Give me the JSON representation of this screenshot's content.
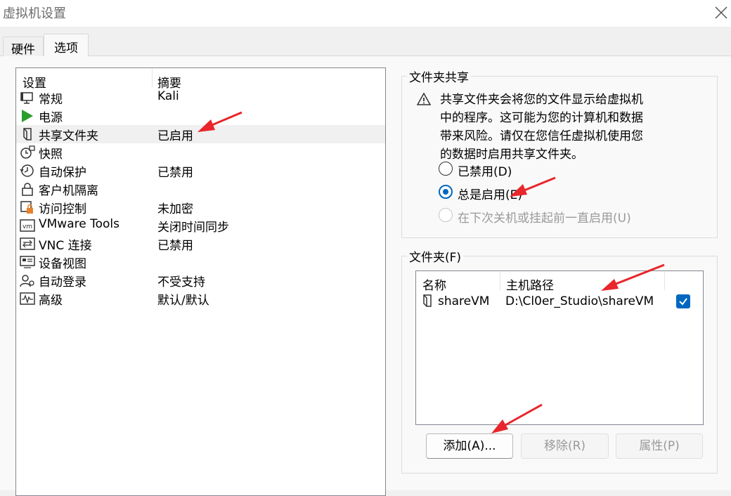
{
  "window": {
    "title": "虚拟机设置"
  },
  "tabs": [
    {
      "label": "硬件",
      "active": false
    },
    {
      "label": "选项",
      "active": true
    }
  ],
  "settings_list": {
    "headers": {
      "setting": "设置",
      "summary": "摘要"
    },
    "items": [
      {
        "name": "常规",
        "summary": "Kali",
        "icon": "monitor-icon"
      },
      {
        "name": "电源",
        "summary": "",
        "icon": "power-play-icon"
      },
      {
        "name": "共享文件夹",
        "summary": "已启用",
        "icon": "shared-folder-icon",
        "selected": true
      },
      {
        "name": "快照",
        "summary": "",
        "icon": "snapshot-icon"
      },
      {
        "name": "自动保护",
        "summary": "已禁用",
        "icon": "autoprotect-clock-icon"
      },
      {
        "name": "客户机隔离",
        "summary": "",
        "icon": "lock-icon"
      },
      {
        "name": "访问控制",
        "summary": "未加密",
        "icon": "access-control-icon"
      },
      {
        "name": "VMware Tools",
        "summary": "关闭时间同步",
        "icon": "vm-tools-icon"
      },
      {
        "name": "VNC 连接",
        "summary": "已禁用",
        "icon": "vnc-icon"
      },
      {
        "name": "设备视图",
        "summary": "",
        "icon": "device-view-icon"
      },
      {
        "name": "自动登录",
        "summary": "不受支持",
        "icon": "autologin-icon"
      },
      {
        "name": "高级",
        "summary": "默认/默认",
        "icon": "advanced-waveform-icon"
      }
    ]
  },
  "folder_sharing": {
    "legend": "文件夹共享",
    "warning_lines": [
      "共享文件夹会将您的文件显示给虚拟机",
      "中的程序。这可能为您的计算机和数据",
      "带来风险。请仅在您信任虚拟机使用您",
      "的数据时启用共享文件夹。"
    ],
    "options": [
      {
        "label": "已禁用(D)",
        "checked": false,
        "disabled": false
      },
      {
        "label": "总是启用(E)",
        "checked": true,
        "disabled": false
      },
      {
        "label": "在下次关机或挂起前一直启用(U)",
        "checked": false,
        "disabled": true
      }
    ]
  },
  "folders": {
    "legend": "文件夹(F)",
    "headers": {
      "name": "名称",
      "host_path": "主机路径"
    },
    "rows": [
      {
        "name": "shareVM",
        "host_path": "D:\\Cl0er_Studio\\shareVM",
        "enabled": true
      }
    ],
    "buttons": {
      "add": "添加(A)...",
      "remove": "移除(R)",
      "properties": "属性(P)"
    }
  },
  "colors": {
    "accent": "#0067c0",
    "annotation_arrow": "#e8262b"
  }
}
